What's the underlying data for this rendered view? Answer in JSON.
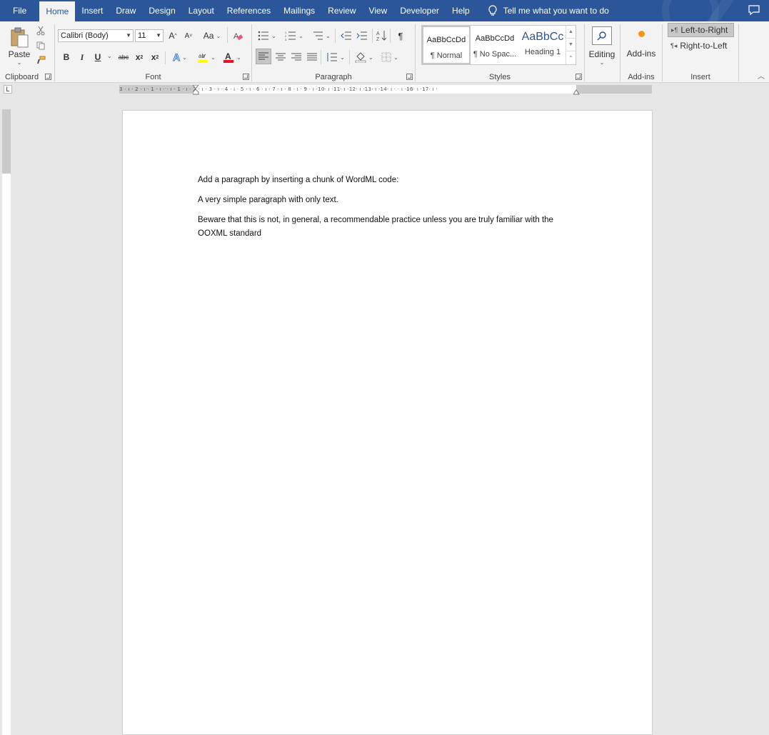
{
  "tabs": {
    "file": "File",
    "home": "Home",
    "insert": "Insert",
    "draw": "Draw",
    "design": "Design",
    "layout": "Layout",
    "references": "References",
    "mailings": "Mailings",
    "review": "Review",
    "view": "View",
    "developer": "Developer",
    "help": "Help"
  },
  "tellme": "Tell me what you want to do",
  "clipboard": {
    "paste": "Paste",
    "label": "Clipboard"
  },
  "font": {
    "name": "Calibri (Body)",
    "size": "11",
    "grow": "A",
    "shrink": "A",
    "case": "Aa",
    "bold": "B",
    "italic": "I",
    "underline": "U",
    "strike": "abc",
    "sub": "x",
    "sup": "x",
    "label": "Font"
  },
  "paragraph": {
    "pilcrow": "¶",
    "label": "Paragraph"
  },
  "styles": {
    "items": [
      {
        "sample": "AaBbCcDd",
        "name": "¶ Normal"
      },
      {
        "sample": "AaBbCcDd",
        "name": "¶ No Spac..."
      },
      {
        "sample": "AaBbCc",
        "name": "Heading 1"
      }
    ],
    "label": "Styles"
  },
  "editing": {
    "label": "Editing"
  },
  "addins": {
    "button": "Add-ins",
    "label": "Add-ins"
  },
  "insert_group": {
    "ltr": "Left-to-Right",
    "rtl": "Right-to-Left",
    "label": "Insert"
  },
  "ruler": {
    "h_ticks": "3 · ı · 2 · ı · 1 · ı ·   · ı · 1 · ı · 2 · ı · 3 · ı · 4 · ı · 5 · ı · 6 · ı · 7 · ı · 8 · ı · 9 · ı ·10· ı ·11· ı ·12· ı ·13· ı ·14· ı ·   · ı ·16· ı ·17· ı ·"
  },
  "document": {
    "paragraphs": [
      "Add a paragraph by inserting a chunk of WordML code:",
      "A very simple paragraph with only text.",
      "Beware that this is not, in general, a recommendable practice unless you are truly familiar with the OOXML standard"
    ]
  },
  "colors": {
    "accent": "#2b579a",
    "highlight": "#ffff00",
    "font_color": "#e81123",
    "addins_dot": "#f7941d"
  }
}
